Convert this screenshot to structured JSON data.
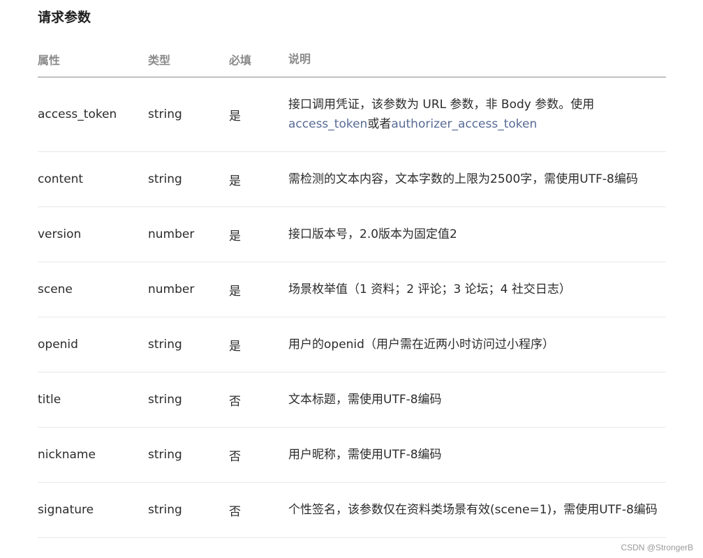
{
  "section": {
    "title": "请求参数"
  },
  "table": {
    "headers": [
      "属性",
      "类型",
      "必填",
      "说明"
    ],
    "rows": [
      {
        "name": "access_token",
        "type": "string",
        "required": "是",
        "desc_line1": "接口调用凭证，该参数为 URL 参数，非 Body 参数。使用",
        "desc_link1": "access_token",
        "desc_mid": "或者",
        "desc_link2": "authorizer_access_token"
      },
      {
        "name": "content",
        "type": "string",
        "required": "是",
        "desc": "需检测的文本内容，文本字数的上限为2500字，需使用UTF-8编码"
      },
      {
        "name": "version",
        "type": "number",
        "required": "是",
        "desc": "接口版本号，2.0版本为固定值2"
      },
      {
        "name": "scene",
        "type": "number",
        "required": "是",
        "desc": "场景枚举值（1 资料；2 评论；3 论坛；4 社交日志）"
      },
      {
        "name": "openid",
        "type": "string",
        "required": "是",
        "desc": "用户的openid（用户需在近两小时访问过小程序）"
      },
      {
        "name": "title",
        "type": "string",
        "required": "否",
        "desc": "文本标题，需使用UTF-8编码"
      },
      {
        "name": "nickname",
        "type": "string",
        "required": "否",
        "desc": "用户昵称，需使用UTF-8编码"
      },
      {
        "name": "signature",
        "type": "string",
        "required": "否",
        "desc": "个性签名，该参数仅在资料类场景有效(scene=1)，需使用UTF-8编码"
      }
    ]
  },
  "watermark": "CSDN @StrongerB"
}
